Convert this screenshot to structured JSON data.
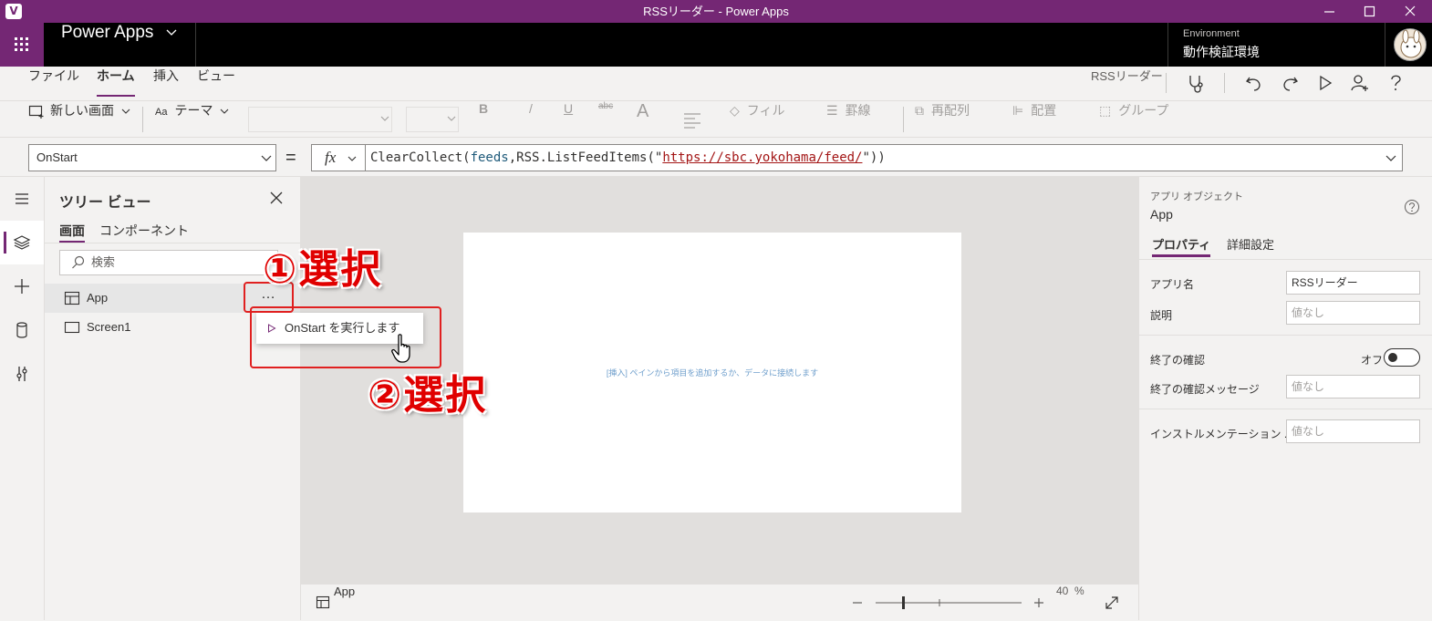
{
  "window": {
    "title": "RSSリーダー - Power Apps",
    "logo_letter": "V"
  },
  "header": {
    "brand": "Power Apps",
    "environment_label": "Environment",
    "environment_value": "動作検証環境"
  },
  "menu": {
    "tabs": [
      "ファイル",
      "ホーム",
      "挿入",
      "ビュー"
    ],
    "active_tab": "ホーム",
    "app_title": "RSSリーダー"
  },
  "ribbon": {
    "new_screen": "新しい画面",
    "theme": "テーマ",
    "bold": "B",
    "italic": "/",
    "underline": "U",
    "strike": "abc",
    "font_color": "A",
    "fill": "フィル",
    "border": "罫線",
    "reorder": "再配列",
    "align": "配置",
    "group": "グループ"
  },
  "formula_bar": {
    "property": "OnStart",
    "equals": "=",
    "fx": "fx",
    "formula_parts": {
      "fn": "ClearCollect(",
      "arg1": "feeds",
      "comma_rss": ",RSS.",
      "fn2": "ListFeedItems(\"",
      "url": "https://sbc.yokohama/feed/",
      "close": "\"))"
    }
  },
  "tree_view": {
    "title": "ツリー ビュー",
    "tabs": [
      "画面",
      "コンポーネント"
    ],
    "search_placeholder": "検索",
    "items": [
      {
        "label": "App",
        "icon": "app-icon",
        "selected": true
      },
      {
        "label": "Screen1",
        "icon": "screen-icon",
        "selected": false
      }
    ],
    "more_label": "…"
  },
  "context_menu": {
    "item": "OnStart を実行します"
  },
  "canvas": {
    "hint": "[挿入] ペインから項目を追加するか、データに接続します"
  },
  "status_bar": {
    "selected": "App",
    "zoom_value": "40",
    "zoom_unit": "%"
  },
  "properties": {
    "type": "アプリ オブジェクト",
    "name": "App",
    "tabs": [
      "プロパティ",
      "詳細設定"
    ],
    "fields": {
      "app_name_label": "アプリ名",
      "app_name_value": "RSSリーダー",
      "description_label": "説明",
      "description_placeholder": "値なし",
      "confirm_exit_label": "終了の確認",
      "confirm_exit_state": "オフ",
      "confirm_msg_label": "終了の確認メッセージ",
      "confirm_msg_placeholder": "値なし",
      "instrumentation_label": "インストルメンテーション ...",
      "instrumentation_placeholder": "値なし"
    }
  },
  "annotations": {
    "step1": "①選択",
    "step2": "②選択",
    "color": "#e00000"
  },
  "colors": {
    "brand": "#742774",
    "header_bg": "#000000",
    "accent_line": "#742774"
  }
}
